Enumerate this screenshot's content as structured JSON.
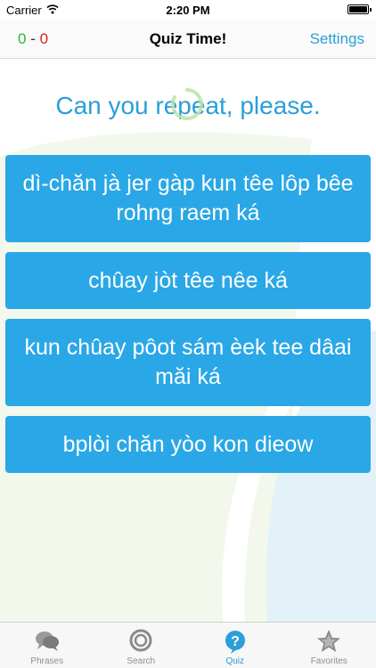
{
  "status_bar": {
    "carrier": "Carrier",
    "time": "2:20 PM"
  },
  "nav": {
    "score_correct": "0",
    "score_separator": "-",
    "score_wrong": "0",
    "title": "Quiz Time!",
    "settings_label": "Settings"
  },
  "quiz": {
    "question": "Can you repeat, please.",
    "answers": [
      "dì-chăn jà jer gàp kun têe lôp bêe rohng raem ká",
      "chûay jòt têe nêe ká",
      "kun chûay pôot sám èek tee dâai măi ká",
      "bplòi chăn yòo kon dieow"
    ]
  },
  "tabs": [
    {
      "label": "Phrases",
      "icon": "speech-bubbles-icon"
    },
    {
      "label": "Search",
      "icon": "search-icon"
    },
    {
      "label": "Quiz",
      "icon": "quiz-icon",
      "active": true
    },
    {
      "label": "Favorites",
      "icon": "star-icon"
    }
  ],
  "colors": {
    "accent": "#2b9fd8",
    "answer_bg": "#2aa7e6",
    "correct": "#2db82d",
    "wrong": "#e02020"
  }
}
